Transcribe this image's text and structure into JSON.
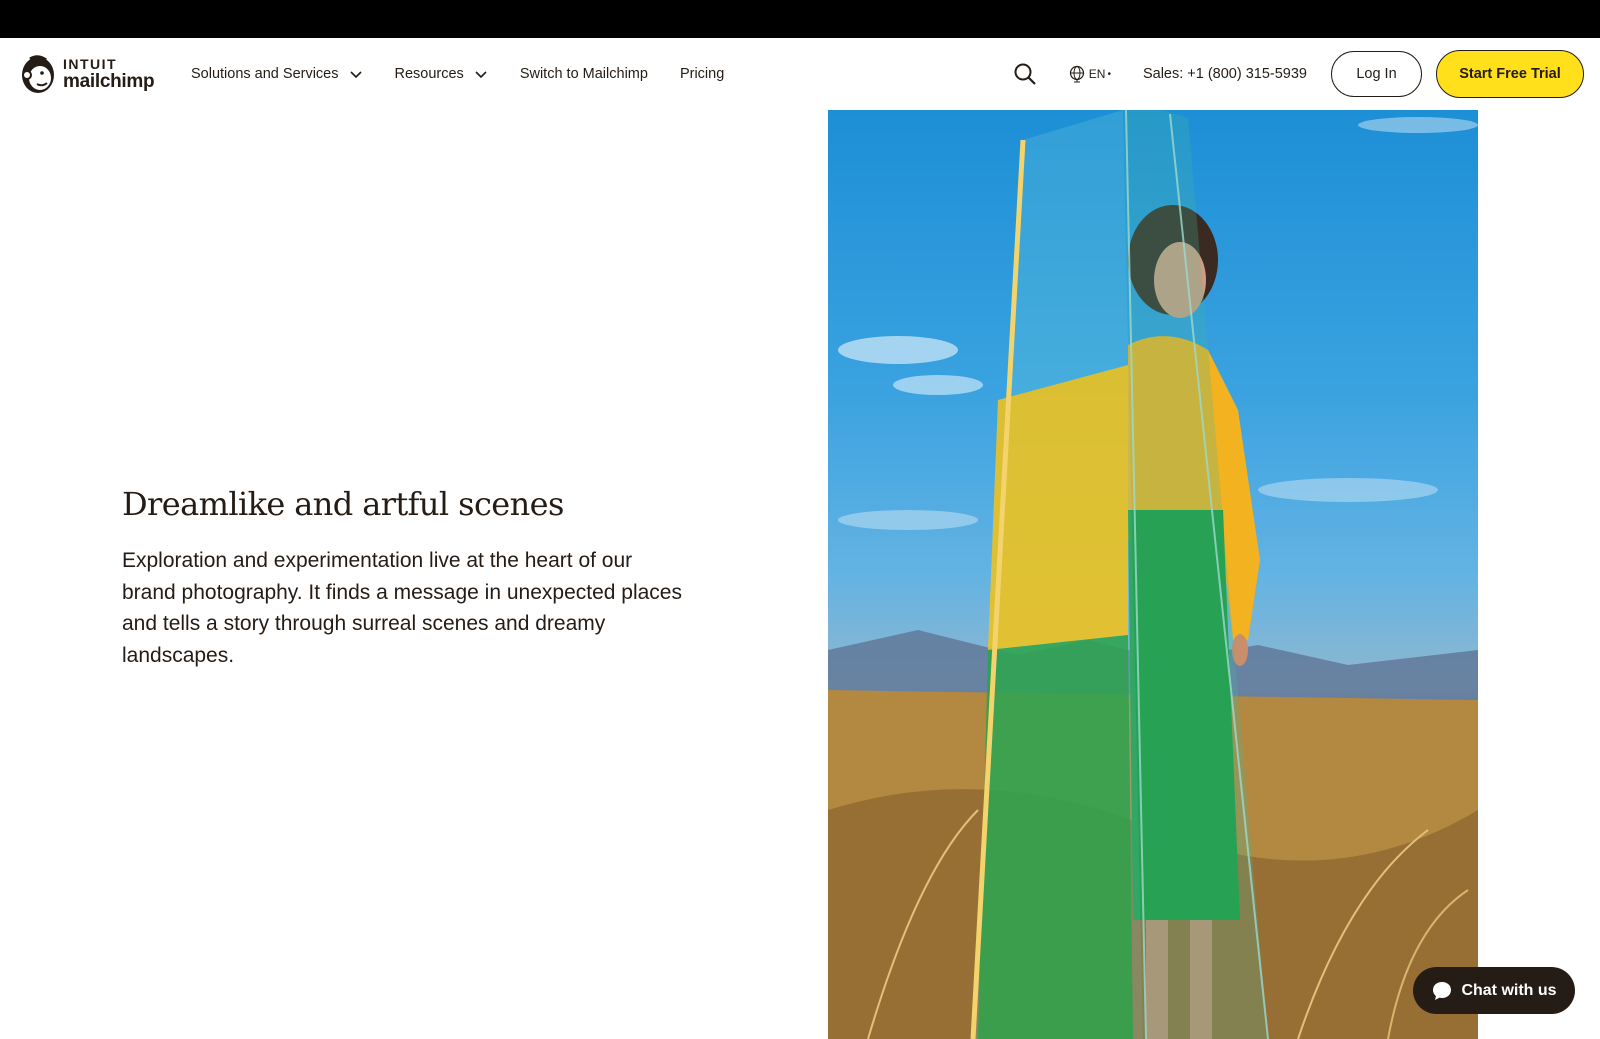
{
  "header": {
    "logo": {
      "brand": "INTUIT",
      "name": "mailchimp",
      "icon": "freddie-monkey-logo"
    },
    "nav": [
      {
        "label": "Solutions and Services",
        "has_dropdown": true
      },
      {
        "label": "Resources",
        "has_dropdown": true
      },
      {
        "label": "Switch to Mailchimp",
        "has_dropdown": false
      },
      {
        "label": "Pricing",
        "has_dropdown": false
      }
    ],
    "search_icon": "search-icon",
    "language": {
      "code": "EN",
      "icon": "globe-icon"
    },
    "sales": "Sales: +1 (800) 315-5939",
    "login_label": "Log In",
    "trial_label": "Start Free Trial"
  },
  "section": {
    "title": "Dreamlike and artful scenes",
    "body": "Exploration and experimentation live at the heart of our brand photography. It finds a message in unexpected places and tells a story through surreal scenes and dreamy landscapes."
  },
  "chat": {
    "label": "Chat with us",
    "icon": "chat-bubble-icon"
  },
  "colors": {
    "accent_yellow": "#ffe01b",
    "text": "#241c15",
    "topbar": "#000000"
  }
}
